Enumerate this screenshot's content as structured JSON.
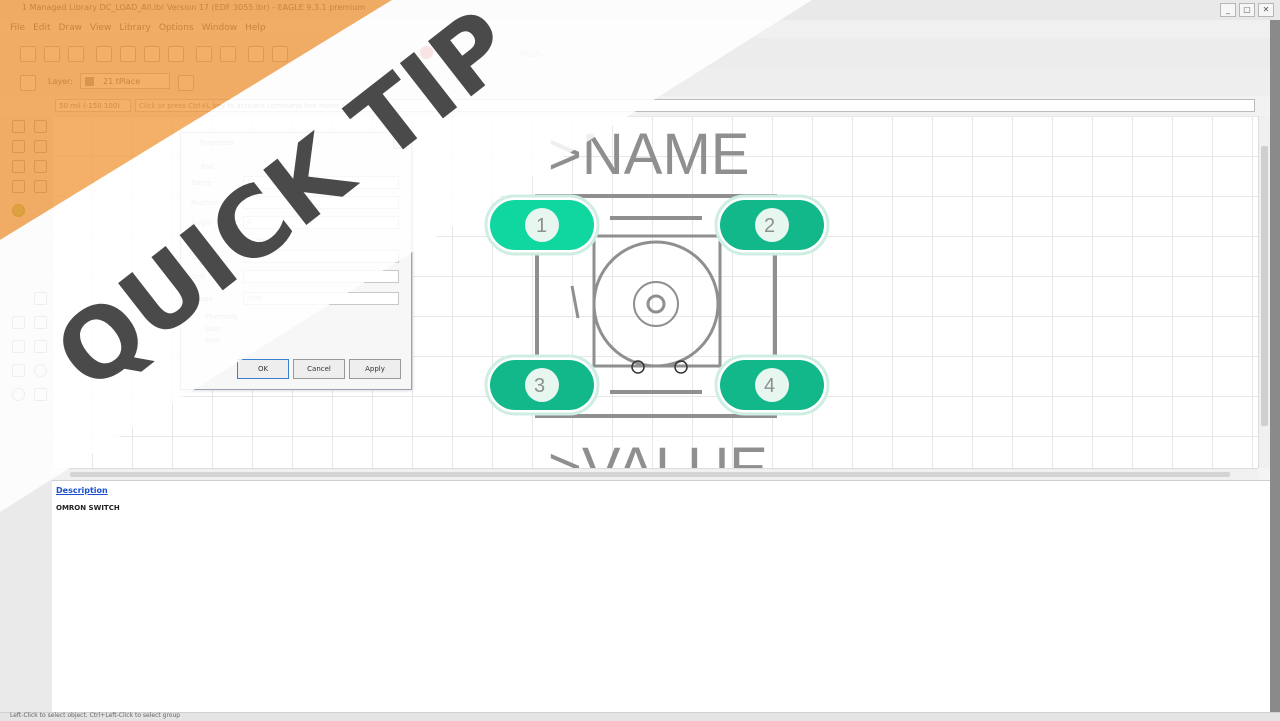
{
  "window": {
    "title": "1 Managed Library DC_LOAD_All.lbr Version 17 (EDF 3055.lbr) - EAGLE 9.3.1 premium",
    "controls": [
      "_",
      "▢",
      "✕"
    ]
  },
  "menu": [
    "File",
    "Edit",
    "Draw",
    "View",
    "Library",
    "Options",
    "Window",
    "Help"
  ],
  "toolbar": {
    "faded_label": "PADS"
  },
  "layer": {
    "label": "Layer:",
    "selected": "21 tPlace"
  },
  "coords": {
    "value": "50 mil (-150 100)",
    "command_placeholder": "Click or press Ctrl+L key to activate command line mode"
  },
  "dialog": {
    "title": "Properties",
    "close": "✕",
    "group": "Pad",
    "fields": [
      {
        "label": "Name",
        "value": "1"
      },
      {
        "label": "Position",
        "value": ""
      },
      {
        "label": "Angle",
        "value": "0"
      },
      {
        "label": "Mirror",
        "value": ""
      },
      {
        "label": "Diameter",
        "value": ""
      },
      {
        "label": "Drill",
        "value": ""
      },
      {
        "label": "Shape",
        "value": "long"
      }
    ],
    "checks": [
      "Thermals",
      "Stop",
      "First"
    ],
    "buttons": {
      "ok": "OK",
      "cancel": "Cancel",
      "apply": "Apply"
    }
  },
  "footprint": {
    "name_label": ">NAME",
    "value_label": ">VALUE",
    "pads": [
      "1",
      "2",
      "3",
      "4"
    ],
    "pad_color": "#12b88a",
    "pad_highlight_color": "#10d6a0",
    "silkscreen_color": "#8f8f8f"
  },
  "description": {
    "link": "Description",
    "text": "OMRON SWITCH"
  },
  "status": {
    "text": "Left-Click to select object. Ctrl+Left-Click to select group"
  },
  "banner": {
    "text": "QUICK TIP",
    "orange": "#f19a3e",
    "ink": "#4a4a4a"
  }
}
